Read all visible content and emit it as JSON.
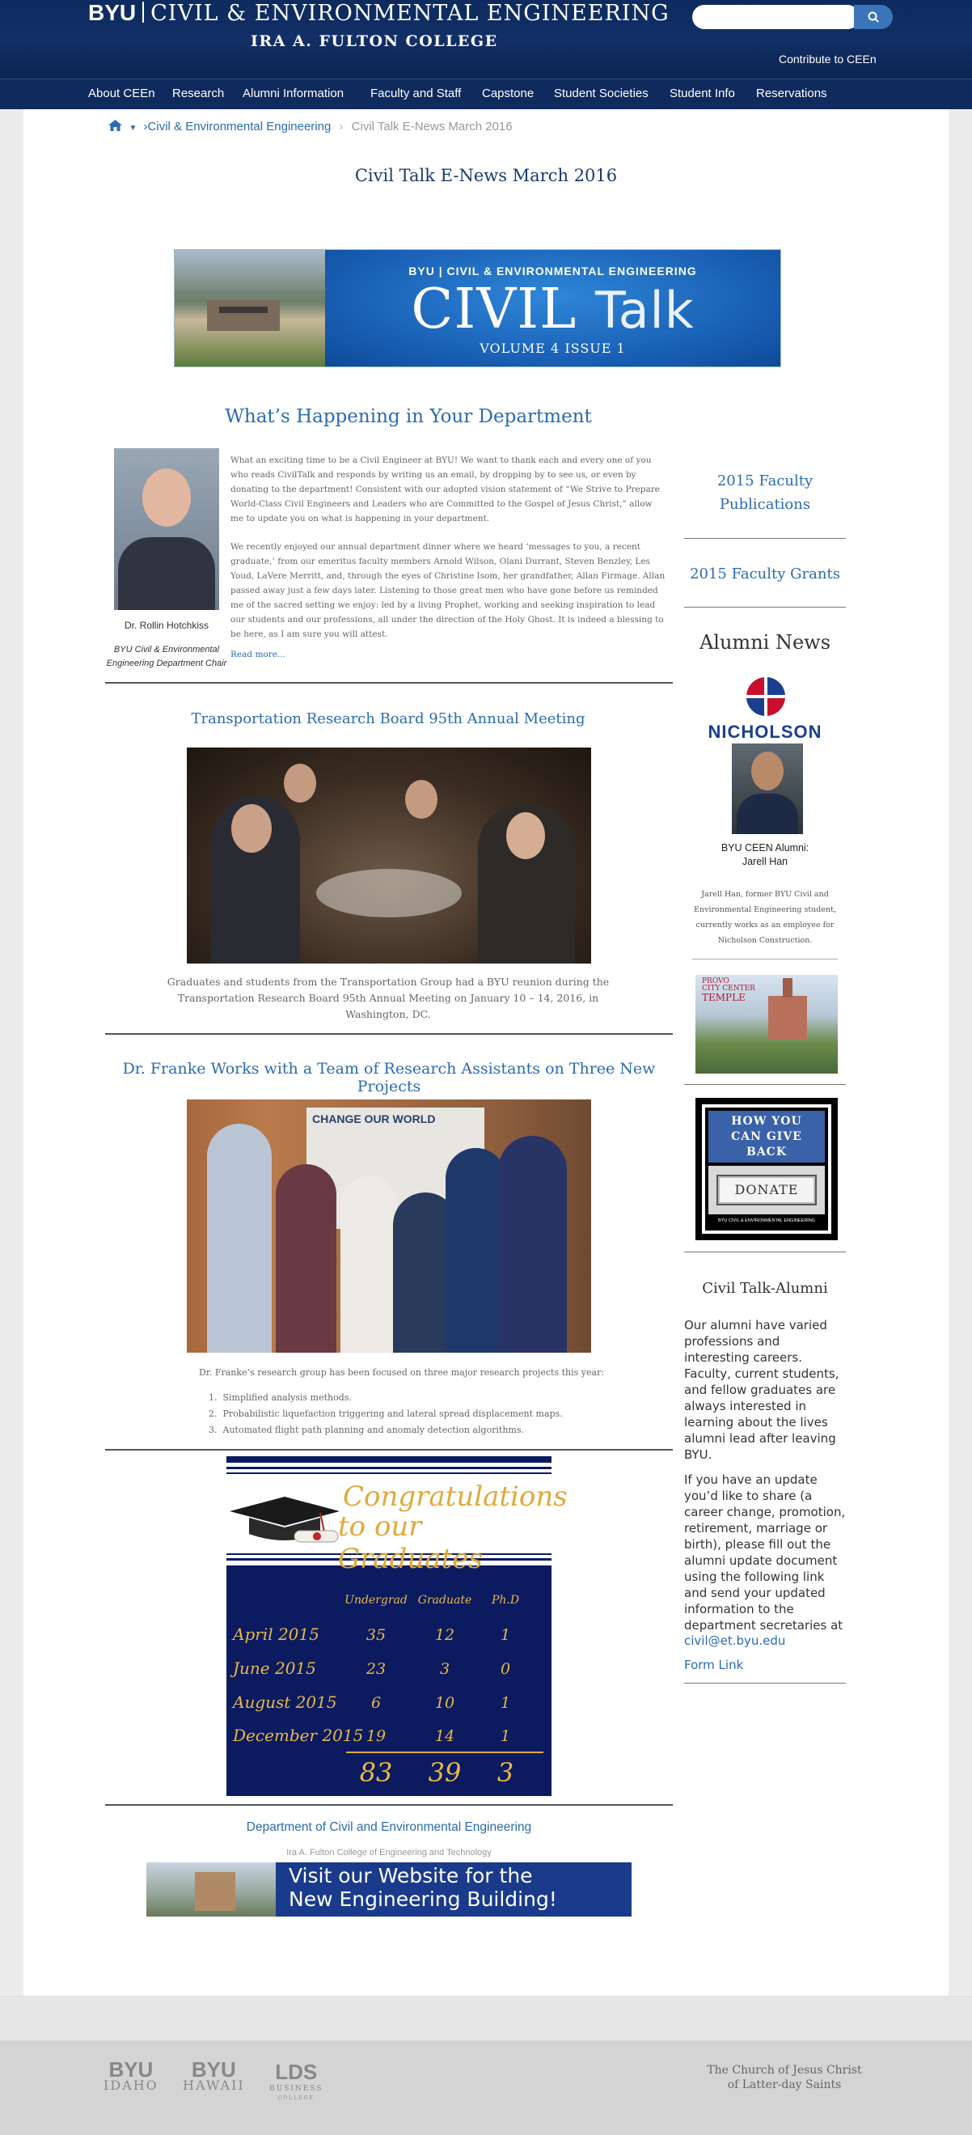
{
  "header": {
    "byu": "BYU",
    "department": "CIVIL & ENVIRONMENTAL ENGINEERING",
    "college": "IRA A. FULTON COLLEGE",
    "search_placeholder": "",
    "contribute": "Contribute to CEEn"
  },
  "nav": {
    "items": [
      "About CEEn",
      "Research",
      "Alumni Information",
      "Faculty and Staff",
      "Capstone",
      "Student Societies",
      "Student Info",
      "Reservations"
    ]
  },
  "breadcrumb": {
    "home_icon": "home-icon",
    "link": "Civil & Environmental Engineering",
    "current": "Civil Talk E-News March 2016"
  },
  "page": {
    "title": "Civil Talk E-News March 2016"
  },
  "banner": {
    "top": "BYU | CIVIL & ENVIRONMENTAL ENGINEERING",
    "civil": "CIVIL",
    "talk": "Talk",
    "volume": "VOLUME 4 ISSUE 1"
  },
  "article1": {
    "title": "What’s Happening in Your Department",
    "name": "Dr. Rollin Hotchkiss",
    "role": "BYU Civil & Environmental Engineering Department Chair",
    "p1": "What an exciting time to be a Civil Engineer at BYU! We want to thank each and every one of you who reads CivilTalk and responds by writing us an email, by dropping by to see us, or even by donating to the department! Consistent with our adopted vision statement of “We Strive to Prepare World-Class Civil Engineers and Leaders who are Committed to the Gospel of Jesus Christ,” allow me to update you on what is happening in your department.",
    "p2": "We recently enjoyed our annual department dinner where we heard ‘messages to you, a recent graduate,’ from our emeritus faculty members Arnold Wilson, Olani Durrant, Steven Benzley, Les Youd, LaVere Merritt, and, through the eyes of Christine Isom, her grandfather, Allan Firmage. Allan passed away just a few days later. Listening to those great men who have gone before us reminded me of the sacred setting we enjoy: led by a living Prophet, working and seeking inspiration to lead our students and our professions, all under the direction of the Holy Ghost. It is indeed a blessing to be here, as I am sure you will attest.",
    "read_more": "Read more..."
  },
  "article2": {
    "title": "Transportation Research Board 95th Annual Meeting",
    "caption": "Graduates and students from the Transportation Group had a BYU reunion during the Transportation Research Board 95th Annual Meeting on January 10 – 14, 2016, in Washington, DC."
  },
  "article3": {
    "title": "Dr. Franke Works with a Team of Research Assistants on Three New Projects",
    "sign": "CHANGE OUR WORLD",
    "intro": "Dr. Franke’s research group has been focused on three major research projects this year:",
    "items": [
      "Simplified analysis methods.",
      "Probabilistic liquefaction triggering and lateral spread displacement maps.",
      "Automated flight path planning and anomaly detection algorithms."
    ]
  },
  "graduates": {
    "title1": "Congratulations",
    "title2": "to our Graduates",
    "headers": [
      "Undergrad",
      "Graduate",
      "Ph.D"
    ],
    "rows": [
      {
        "term": "April 2015",
        "values": [
          "35",
          "12",
          "1"
        ]
      },
      {
        "term": "June 2015",
        "values": [
          "23",
          "3",
          "0"
        ]
      },
      {
        "term": "August 2015",
        "values": [
          "6",
          "10",
          "1"
        ]
      },
      {
        "term": "December 2015",
        "values": [
          "19",
          "14",
          "1"
        ]
      }
    ],
    "totals": [
      "83",
      "39",
      "3"
    ]
  },
  "footer_block": {
    "dept": "Department of Civil and Environmental Engineering",
    "college": "Ira A. Fulton College of Engineering and Technology",
    "visit1": "Visit our Website for the",
    "visit2": "New Engineering Building!"
  },
  "sidebar": {
    "pubs": "2015 Faculty Publications",
    "grants": "2015 Faculty Grants",
    "alumni_news": "Alumni News",
    "nicholson": "NICHOLSON",
    "alumni_name1": "BYU CEEN Alumni:",
    "alumni_name2": "Jarell Han",
    "alumni_text": "Jarell Han, former BYU Civil and Environmental Engineering student, currently works as an employee for Nicholson Construction.",
    "temple1": "PROVO",
    "temple2": "CITY CENTER",
    "temple3": "TEMPLE",
    "give1": "HOW YOU",
    "give2": "CAN GIVE",
    "give3": "BACK",
    "donate": "DONATE",
    "give_foot": "BYU CIVIL & ENVIRONMENTAL ENGINEERING",
    "ct_alumni": "Civil Talk-Alumni",
    "p1": "Our alumni have varied professions and interesting careers. Faculty, current students, and fellow graduates are always interested in learning about the lives alumni lead after leaving BYU.",
    "p2": "If you have an update you’d like to share (a career change, promotion, retirement, marriage or birth), please fill out the alumni update document using the following link and send your updated information to the department secretaries at",
    "email": "civil@et.byu.edu",
    "form_link": "Form Link"
  },
  "footer": {
    "byu_idaho_1": "BYU",
    "byu_idaho_2": "IDAHO",
    "byu_hawaii_1": "BYU",
    "byu_hawaii_2": "HAWAII",
    "lds_1": "LDS",
    "lds_2": "BUSINESS",
    "lds_3": "COLLEGE",
    "church1": "The Church of Jesus Christ",
    "church2": "of Latter-day Saints"
  }
}
